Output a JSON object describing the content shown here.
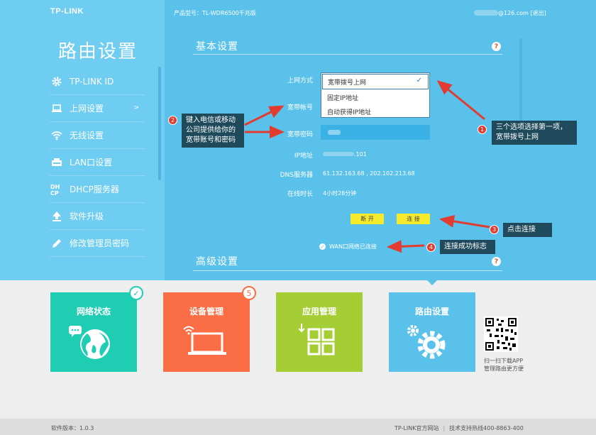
{
  "brand": {
    "logo": "TP-LINK"
  },
  "header": {
    "product_model": "产品型号：TL-WDR6500千兆版",
    "user_email_suffix": "@126.com",
    "logout": "[退出]"
  },
  "sidebar": {
    "title": "路由设置",
    "items": [
      {
        "label": "TP-LINK ID",
        "icon": "gear-icon"
      },
      {
        "label": "上网设置",
        "icon": "laptop-icon",
        "chevron": ">"
      },
      {
        "label": "无线设置",
        "icon": "wifi-icon"
      },
      {
        "label": "LAN口设置",
        "icon": "lan-icon"
      },
      {
        "label": "DHCP服务器",
        "icon": "dhcp-icon"
      },
      {
        "label": "软件升级",
        "icon": "upload-icon"
      },
      {
        "label": "修改管理员密码",
        "icon": "pencil-icon"
      }
    ]
  },
  "basic": {
    "title": "基本设置",
    "help": "?",
    "wan_type_label": "上网方式",
    "wan_type_selected": "宽带拨号上网",
    "wan_type_options": [
      "固定IP地址",
      "自动获得IP地址"
    ],
    "account_label": "宽带帐号",
    "password_label": "宽带密码",
    "ip_label": "IP地址",
    "ip_value": ".101",
    "dns_label": "DNS服务器",
    "dns_value": "61.132.163.68 , 202.102.213.68",
    "uptime_label": "在线时长",
    "uptime_value": "4小时28分钟",
    "disconnect_label": "断 开",
    "connect_label": "连 接",
    "wan_status": "WAN口网络已连接"
  },
  "advanced": {
    "title": "高级设置",
    "help": "?"
  },
  "callouts": {
    "c1": {
      "num": "1",
      "text": "三个选项选择第一项，宽带拨号上网"
    },
    "c2": {
      "num": "2",
      "text": "键入电信或移动公司提供给你的宽带账号和密码"
    },
    "c3": {
      "num": "3",
      "text": "点击连接"
    },
    "c4": {
      "num": "4",
      "text": "连接成功标志"
    }
  },
  "tiles": [
    {
      "title": "网络状态",
      "color": "#1fcdb3",
      "badge": "✓"
    },
    {
      "title": "设备管理",
      "color": "#fb6d45",
      "badge": "5"
    },
    {
      "title": "应用管理",
      "color": "#a5cd34"
    },
    {
      "title": "路由设置",
      "color": "#59c1ea"
    }
  ],
  "qr": {
    "caption": "扫一扫下载APP管理路由更方便"
  },
  "footer": {
    "version": "软件版本：1.0.3",
    "site": "TP-LINK官方网站",
    "hotline": "技术支持热线400-8863-400"
  },
  "colors": {
    "header_bg": "#59c1ea",
    "sidebar_bg": "#6ecdf0",
    "button_yellow": "#f6ea2d",
    "callout_bg": "#1e4a5b",
    "arrow_red": "#e23b2f"
  }
}
